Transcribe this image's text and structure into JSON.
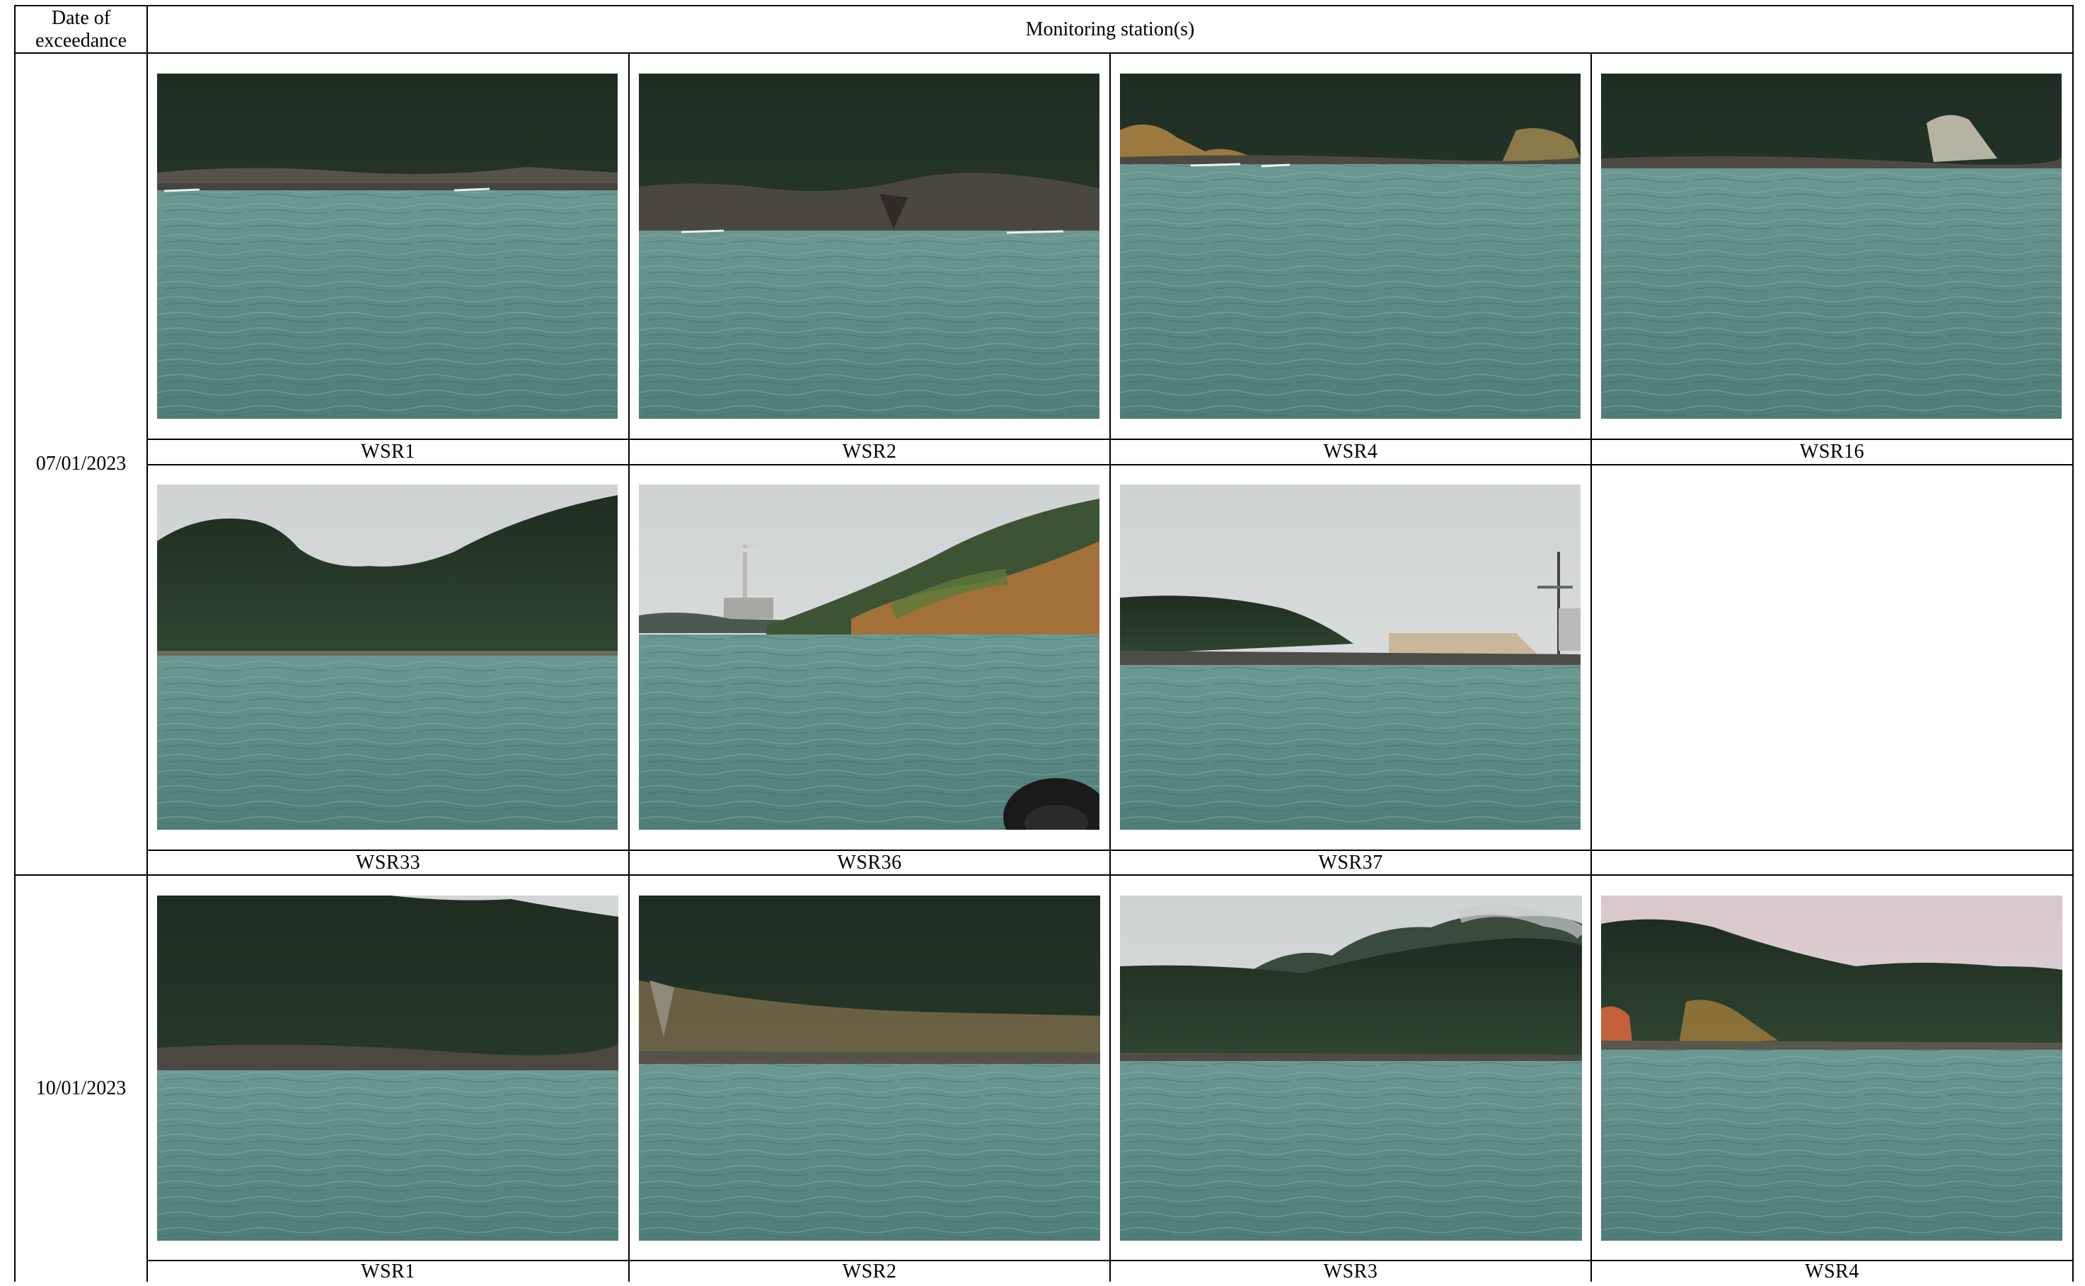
{
  "table": {
    "header": {
      "date_col": "Date of exceedance",
      "stations_col": "Monitoring station(s)"
    },
    "groups": [
      {
        "date": "07/01/2023",
        "rows": [
          {
            "photos": [
              {
                "label": "WSR1",
                "scene": "rocky-shore"
              },
              {
                "label": "WSR2",
                "scene": "rocky-shore-close"
              },
              {
                "label": "WSR4",
                "scene": "rocky-shore-orange"
              },
              {
                "label": "WSR16",
                "scene": "rocky-shore-cliff"
              }
            ]
          },
          {
            "photos": [
              {
                "label": "WSR33",
                "scene": "hills-sky"
              },
              {
                "label": "WSR36",
                "scene": "crane-hillside"
              },
              {
                "label": "WSR37",
                "scene": "crane-low-shore"
              },
              {
                "label": "",
                "scene": "empty"
              }
            ]
          }
        ]
      },
      {
        "date": "10/01/2023",
        "rows": [
          {
            "photos": [
              {
                "label": "WSR1",
                "scene": "hillside-sky-corner"
              },
              {
                "label": "WSR2",
                "scene": "rocky-shore-beach"
              },
              {
                "label": "WSR3",
                "scene": "mountains-cloud"
              },
              {
                "label": "WSR4",
                "scene": "pink-sky-orange-cliff"
              }
            ]
          }
        ]
      }
    ]
  },
  "colors": {
    "water": "#5f8d86",
    "forest": "#26392a",
    "sky": "#d9dbdb",
    "rock": "#5b564c"
  }
}
